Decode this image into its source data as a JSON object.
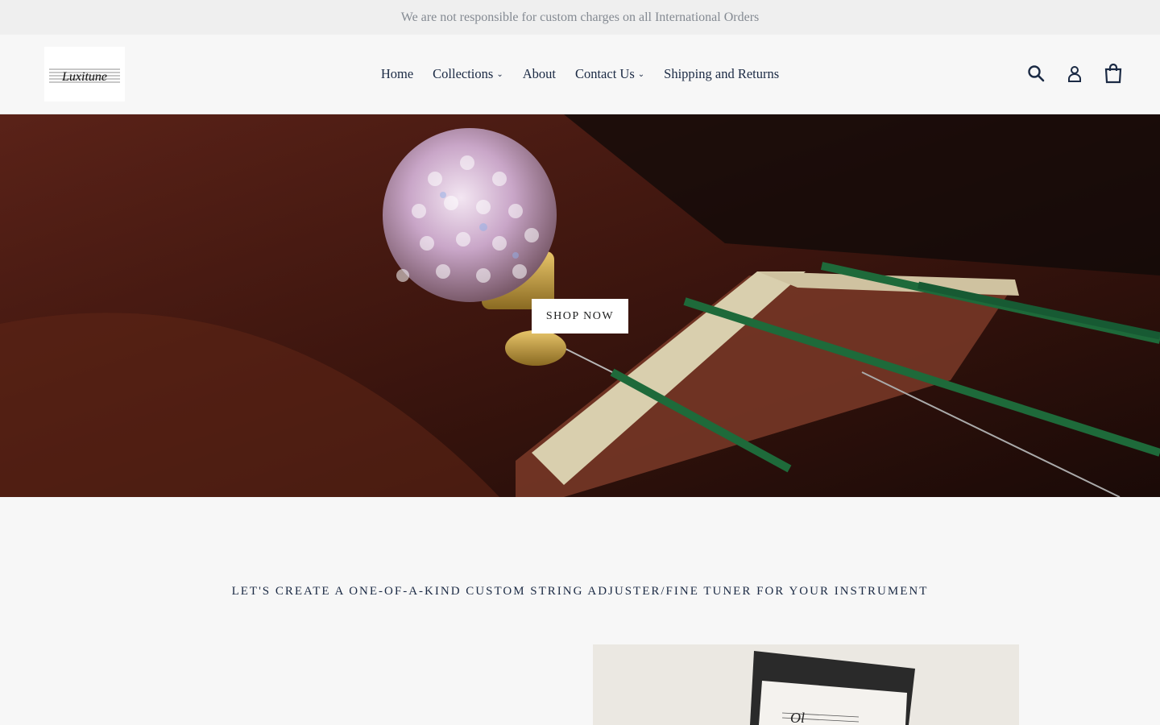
{
  "announcement": {
    "text": "We are not responsible for custom charges on all International Orders"
  },
  "header": {
    "logo_text": "Luxitune",
    "nav": [
      {
        "label": "Home",
        "has_dropdown": false
      },
      {
        "label": "Collections",
        "has_dropdown": true
      },
      {
        "label": "About",
        "has_dropdown": false
      },
      {
        "label": "Contact Us",
        "has_dropdown": true
      },
      {
        "label": "Shipping and Returns",
        "has_dropdown": false
      }
    ],
    "icons": [
      "search-icon",
      "account-icon",
      "cart-icon"
    ]
  },
  "hero": {
    "button_label": "SHOP NOW"
  },
  "feature": {
    "heading": "LET'S CREATE A ONE-OF-A-KIND CUSTOM STRING ADJUSTER/FINE TUNER FOR YOUR INSTRUMENT"
  },
  "colors": {
    "nav_text": "#1b2a44",
    "announcement_bg": "#efefef",
    "page_bg": "#f7f7f7"
  }
}
